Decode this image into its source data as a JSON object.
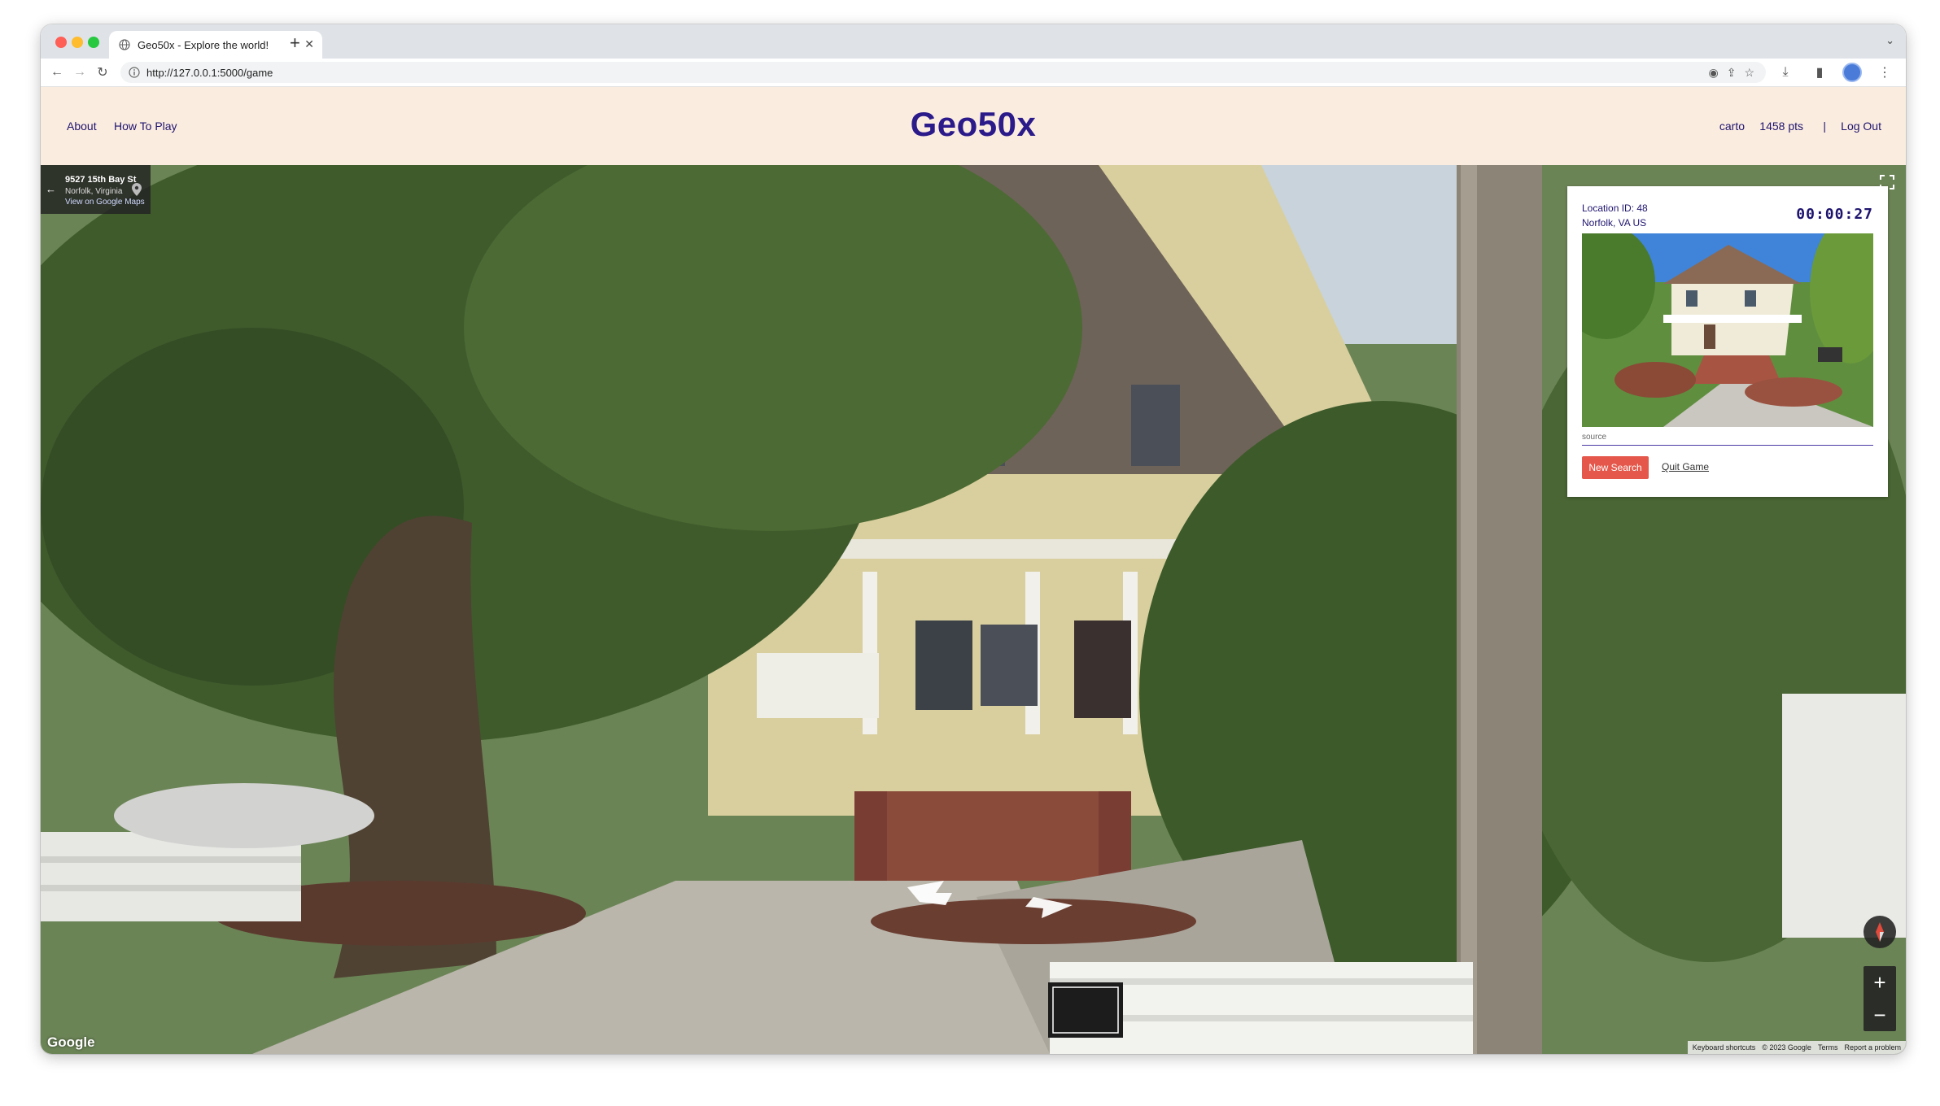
{
  "browser": {
    "tab_title": "Geo50x - Explore the world!",
    "url": "http://127.0.0.1:5000/game"
  },
  "nav": {
    "about": "About",
    "how_to_play": "How To Play",
    "logo": "Geo50x",
    "username": "carto",
    "points": "1458 pts",
    "separator": "|",
    "logout": "Log Out"
  },
  "streetview": {
    "address_street": "9527 15th Bay St",
    "address_city": "Norfolk, Virginia",
    "view_on_maps": "View on Google Maps",
    "google_mark": "Google",
    "keyboard_shortcuts": "Keyboard shortcuts",
    "copyright": "© 2023 Google",
    "terms": "Terms",
    "report": "Report a problem"
  },
  "game_card": {
    "location_id": "Location ID: 48",
    "location_place": "Norfolk, VA US",
    "timer": "00:00:27",
    "source_label": "source",
    "new_search_label": "New Search",
    "quit_label": "Quit Game"
  },
  "colors": {
    "header_bg": "#fbece0",
    "brand_text": "#2a1a8a",
    "new_search_button": "#e4574a"
  }
}
